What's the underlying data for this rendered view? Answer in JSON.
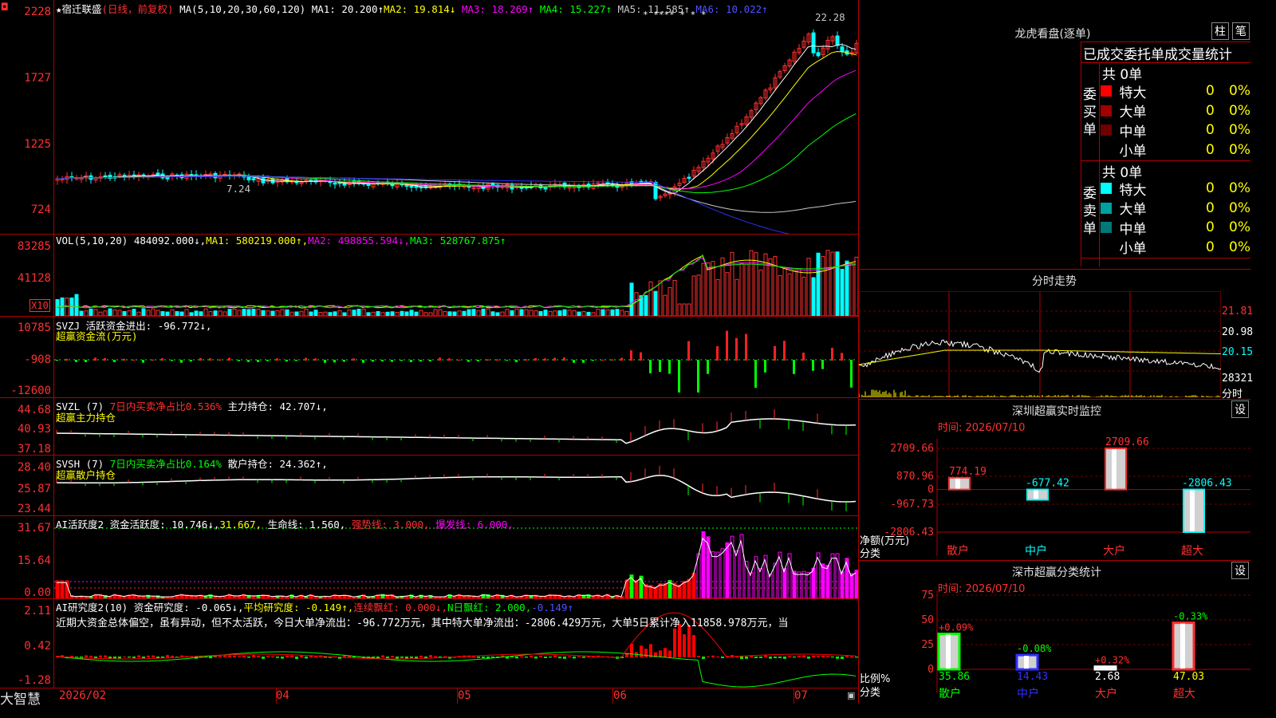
{
  "stock": {
    "title": "★宿迁联盛",
    "period": "(日线，前复权)",
    "ma_label": "MA(5,10,20,30,60,120)",
    "ma1": "MA1: 20.200↑",
    "ma2": "MA2: 19.814↓",
    "ma3": "MA3: 18.269↑",
    "ma4": "MA4: 15.227↑",
    "ma5": "MA5: 11.585↑",
    "ma6": "MA6: 10.022↑",
    "high_mark": "22.28",
    "low_mark": "7.24",
    "star_marks": "* ****  *  * *",
    "y_labels": [
      "2228",
      "1727",
      "1225",
      "724"
    ]
  },
  "vol": {
    "label": "VOL(5,10,20)",
    "value": "484092.000↓,",
    "ma1": "MA1: 580219.000↑,",
    "ma2": "MA2: 498855.594↓,",
    "ma3": "MA3: 528767.875↑",
    "y_labels": [
      "83285",
      "41128"
    ],
    "unit": "X10"
  },
  "svzj": {
    "label": "SVZJ",
    "line1": "活跃资金进出: -96.772↓,",
    "line2": "超赢资金流(万元)",
    "y_labels": [
      "10785",
      "-908",
      "-12600"
    ]
  },
  "svzl": {
    "label": "SVZL (7)",
    "desc": "7日内买卖净占比0.536%",
    "val": "主力持仓: 42.707↓,",
    "line2": "超赢主力持仓",
    "y_labels": [
      "44.68",
      "40.93",
      "37.18"
    ]
  },
  "svsh": {
    "label": "SVSH (7)",
    "desc": "7日内买卖净占比0.164%",
    "val": "散户持仓: 24.362↑,",
    "line2": "超赢散户持仓",
    "y_labels": [
      "28.40",
      "25.87",
      "23.44"
    ]
  },
  "ai_active": {
    "label": "AI活跃度2",
    "val1": "资金活跃度: 10.746↓,",
    "val2": "31.667,",
    "val3": "生命线: 1.560,",
    "val4": "强势线: 3.000,",
    "val5": "爆发线: 6.000,",
    "y_labels": [
      "31.67",
      "15.64",
      "0.00"
    ]
  },
  "ai_research": {
    "label": "AI研究度2(10)",
    "val1": "资金研究度: -0.065↓,",
    "val2": "平均研究度: -0.149↑,",
    "val3": "连续飘红: 0.000↓,",
    "val4": "N日飘红: 2.000,",
    "val5": "-0.149↑",
    "summary": "近期大资金总体偏空，虽有异动，但不太活跃，今日大单净流出：-96.772万元，其中特大单净流出：-2806.429万元，大单5日累计净入11858.978万元，当",
    "y_labels": [
      "2.11",
      "0.42",
      "-1.28"
    ]
  },
  "xaxis": {
    "app": "大智慧",
    "labels": [
      "2026/02",
      "04",
      "05",
      "06",
      "07"
    ]
  },
  "longhu": {
    "title": "龙虎看盘(逐单)",
    "btn1": "柱",
    "btn2": "笔",
    "header": "已成交委托单成交量统计",
    "buy_label": "委买单",
    "sell_label": "委卖单",
    "buy_total": "共 0单",
    "sell_total": "共 0单",
    "buy_rows": [
      {
        "name": "特大",
        "num": "0",
        "pct": "0%",
        "color": "#ff0000"
      },
      {
        "name": "大单",
        "num": "0",
        "pct": "0%",
        "color": "#a00000"
      },
      {
        "name": "中单",
        "num": "0",
        "pct": "0%",
        "color": "#700000"
      },
      {
        "name": "小单",
        "num": "0",
        "pct": "0%",
        "color": "#000000"
      }
    ],
    "sell_rows": [
      {
        "name": "特大",
        "num": "0",
        "pct": "0%",
        "color": "#00ffff"
      },
      {
        "name": "大单",
        "num": "0",
        "pct": "0%",
        "color": "#00a0a0"
      },
      {
        "name": "中单",
        "num": "0",
        "pct": "0%",
        "color": "#007878"
      },
      {
        "name": "小单",
        "num": "0",
        "pct": "0%",
        "color": "#000000"
      }
    ]
  },
  "intraday": {
    "title": "分时走势",
    "y_labels": [
      "21.81",
      "20.98",
      "20.15",
      "28321",
      "分时"
    ]
  },
  "monitor": {
    "title": "深圳超赢实时监控",
    "btn": "设",
    "time": "时间: 2026/07/10",
    "y_labels": [
      "2709.66",
      "870.96",
      "0",
      "-967.73",
      "-2806.43"
    ],
    "y_unit": "净额(万元)",
    "x_unit": "分类",
    "categories": [
      "散户",
      "中户",
      "大户",
      "超大"
    ],
    "values": [
      774.19,
      -677.42,
      2709.66,
      -2806.43
    ],
    "value_labels": [
      "774.19",
      "-677.42",
      "2709.66",
      "-2806.43"
    ]
  },
  "classify": {
    "title": "深市超赢分类统计",
    "btn": "设",
    "time": "时间: 2026/07/10",
    "y_labels": [
      "75",
      "50",
      "25",
      "0"
    ],
    "y_unit": "比例%",
    "x_unit": "分类",
    "categories": [
      "散户",
      "中户",
      "大户",
      "超大"
    ],
    "values": [
      35.86,
      14.43,
      2.68,
      47.03
    ],
    "value_labels": [
      "35.86",
      "14.43",
      "2.68",
      "47.03"
    ],
    "change_labels": [
      "+0.09%",
      "-0.08%",
      "+0.32%",
      "-0.33%"
    ]
  }
}
